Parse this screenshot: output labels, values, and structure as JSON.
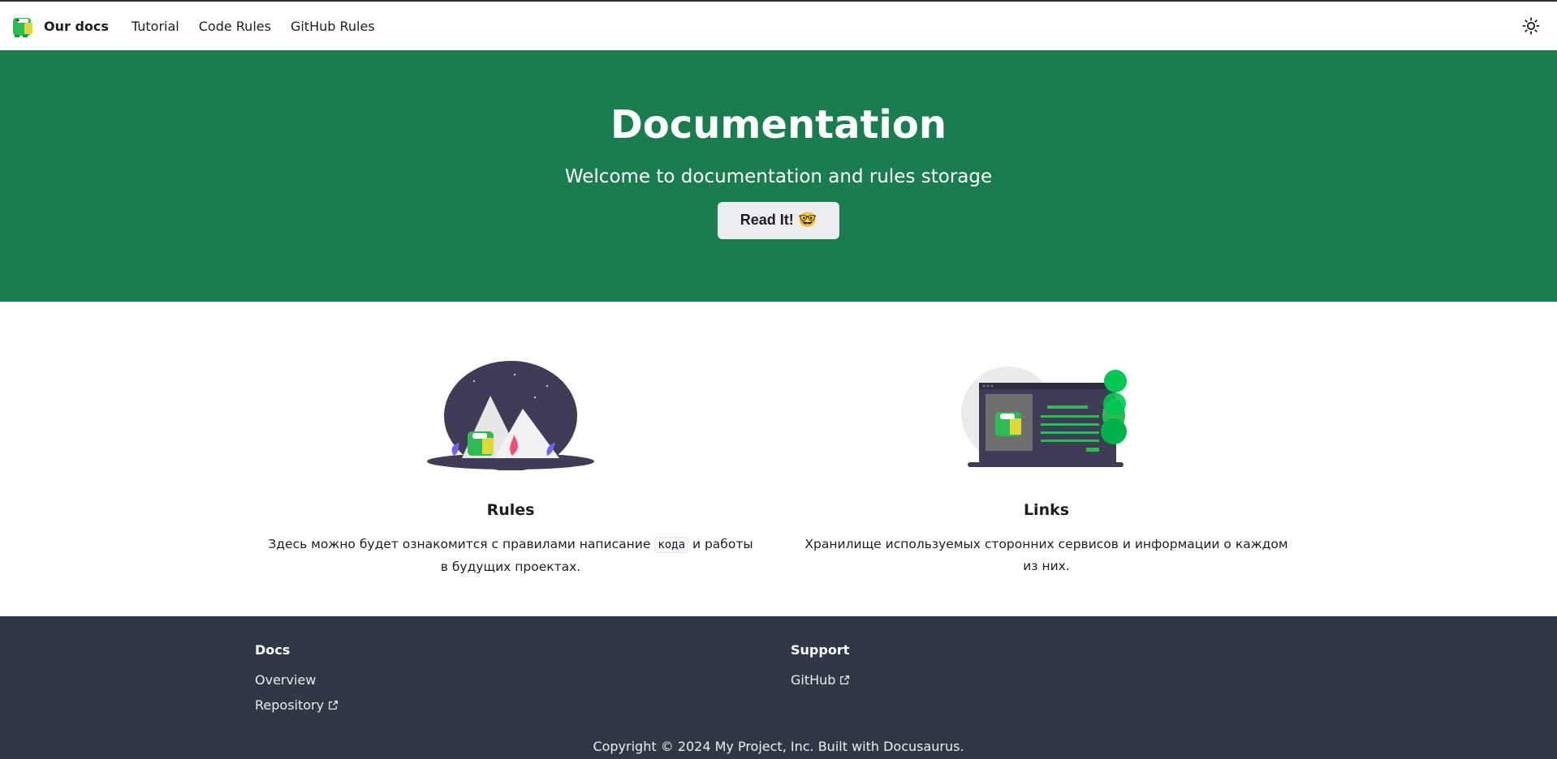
{
  "navbar": {
    "brand_title": "Our docs",
    "links": [
      "Tutorial",
      "Code Rules",
      "GitHub Rules"
    ],
    "theme_toggle_icon": "sun-icon"
  },
  "colors": {
    "hero_bg": "#1a7d4f",
    "footer_bg": "#303846",
    "button_bg": "#ebedf0"
  },
  "hero": {
    "title": "Documentation",
    "subtitle": "Welcome to documentation and rules storage",
    "cta_label": "Read It!",
    "cta_emoji": "🤓"
  },
  "features": [
    {
      "title": "Rules",
      "text_before": "Здесь можно будет ознакомится с правилами написание ",
      "code": "кода",
      "text_after": " и работы в будущих проектах."
    },
    {
      "title": "Links",
      "text": "Хранилище используемых сторонних сервисов и информации о каждом из них."
    }
  ],
  "footer": {
    "columns": [
      {
        "title": "Docs",
        "links": [
          {
            "label": "Overview",
            "external": false
          },
          {
            "label": "Repository",
            "external": true
          }
        ]
      },
      {
        "title": "Support",
        "links": [
          {
            "label": "GitHub",
            "external": true
          }
        ]
      }
    ],
    "copyright": "Copyright © 2024 My Project, Inc. Built with Docusaurus."
  }
}
